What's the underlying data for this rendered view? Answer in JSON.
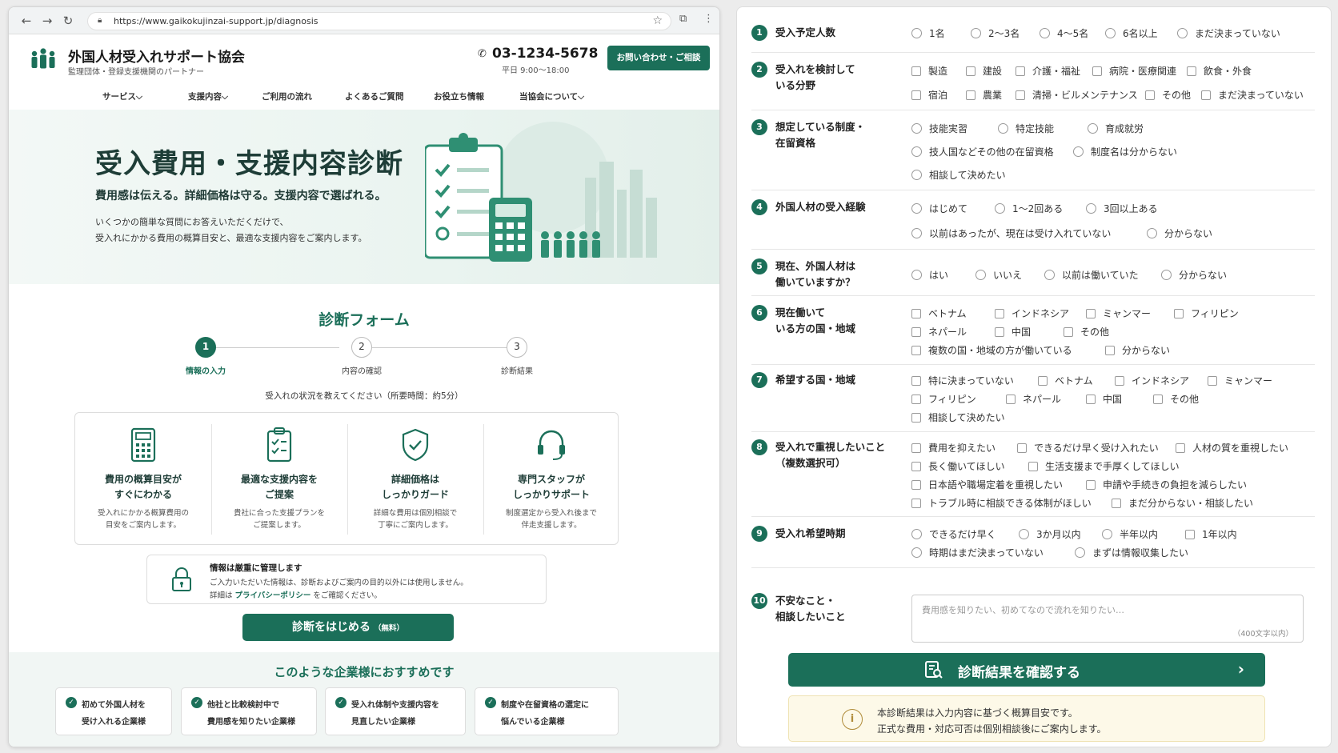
{
  "browser": {
    "url": "https://www.gaikokujinzai-support.jp/diagnosis"
  },
  "site": {
    "name": "外国人材受入れサポート協会",
    "subtitle": "監理団体・登録支援機関のパートナー",
    "phone": "03-1234-5678",
    "hours": "平日 9:00〜18:00",
    "contact_button": "お問い合わせ・ご相談"
  },
  "gnav": [
    "サービス⌵",
    "支援内容⌵",
    "ご利用の流れ",
    "よくあるご質問",
    "お役立ち情報",
    "当協会について⌵"
  ],
  "hero": {
    "title": "受入費用・支援内容診断",
    "subtitle": "費用感は伝える。詳細価格は守る。支援内容で選ばれる。",
    "desc1": "いくつかの簡単な質問にお答えいただくだけで、",
    "desc2": "受入れにかかる費用の概算目安と、最適な支援内容をご案内します。"
  },
  "form": {
    "title": "診断フォーム",
    "steps": [
      {
        "num": "1",
        "label": "情報の入力"
      },
      {
        "num": "2",
        "label": "内容の確認"
      },
      {
        "num": "3",
        "label": "診断結果"
      }
    ],
    "note": "受入れの状況を教えてください（所要時間：約5分）"
  },
  "features": [
    {
      "title1": "費用の概算目安が",
      "title2": "すぐにわかる",
      "desc1": "受入れにかかる概算費用の",
      "desc2": "目安をご案内します。"
    },
    {
      "title1": "最適な支援内容を",
      "title2": "ご提案",
      "desc1": "貴社に合った支援プランを",
      "desc2": "ご提案します。"
    },
    {
      "title1": "詳細価格は",
      "title2": "しっかりガード",
      "desc1": "詳細な費用は個別相談で",
      "desc2": "丁寧にご案内します。"
    },
    {
      "title1": "専門スタッフが",
      "title2": "しっかりサポート",
      "desc1": "制度選定から受入れ後まで",
      "desc2": "伴走支援します。"
    }
  ],
  "privacy": {
    "title": "情報は厳重に管理します",
    "line1": "ご入力いただいた情報は、診断およびご案内の目的以外には使用しません。",
    "line2_pre": "詳細は",
    "link": "プライバシーポリシー",
    "line2_post": "をご確認ください。"
  },
  "start_button": {
    "label": "診断をはじめる",
    "small": "（無料）"
  },
  "recommend": {
    "title": "このような企業様におすすめです",
    "cards": [
      {
        "l1": "初めて外国人材を",
        "l2": "受け入れる企業様"
      },
      {
        "l1": "他社と比較検討中で",
        "l2": "費用感を知りたい企業様"
      },
      {
        "l1": "受入れ体制や支援内容を",
        "l2": "見直したい企業様"
      },
      {
        "l1": "制度や在留資格の選定に",
        "l2": "悩んでいる企業様"
      }
    ]
  },
  "questions": {
    "q1": {
      "num": "1",
      "label": "受入予定人数",
      "options": [
        "1名",
        "2〜3名",
        "4〜5名",
        "6名以上",
        "まだ決まっていない"
      ]
    },
    "q2": {
      "num": "2",
      "label1": "受入れを検討して",
      "label2": "いる分野",
      "options": [
        "製造",
        "建設",
        "介護・福祉",
        "病院・医療関連",
        "飲食・外食",
        "宿泊",
        "農業",
        "清掃・ビルメンテナンス",
        "その他",
        "まだ決まっていない"
      ]
    },
    "q3": {
      "num": "3",
      "label1": "想定している制度・",
      "label2": "在留資格",
      "options": [
        "技能実習",
        "特定技能",
        "育成就労",
        "技人国などその他の在留資格",
        "制度名は分からない",
        "相談して決めたい"
      ]
    },
    "q4": {
      "num": "4",
      "label": "外国人材の受入経験",
      "options": [
        "はじめて",
        "1〜2回ある",
        "3回以上ある",
        "以前はあったが、現在は受け入れていない",
        "分からない"
      ]
    },
    "q5": {
      "num": "5",
      "label1": "現在、外国人材は",
      "label2": "働いていますか？",
      "options": [
        "はい",
        "いいえ",
        "以前は働いていた",
        "分からない"
      ]
    },
    "q6": {
      "num": "6",
      "label1": "現在働いて",
      "label2": "いる方の国・地域",
      "options": [
        "ベトナム",
        "インドネシア",
        "ミャンマー",
        "フィリピン",
        "ネパール",
        "中国",
        "その他",
        "複数の国・地域の方が働いている",
        "分からない"
      ]
    },
    "q7": {
      "num": "7",
      "label": "希望する国・地域",
      "options": [
        "特に決まっていない",
        "ベトナム",
        "インドネシア",
        "ミャンマー",
        "フィリピン",
        "ネパール",
        "中国",
        "その他",
        "相談して決めたい"
      ]
    },
    "q8": {
      "num": "8",
      "label1": "受入れで重視したいこと",
      "label2": "（複数選択可）",
      "options": [
        "費用を抑えたい",
        "できるだけ早く受け入れたい",
        "人材の質を重視したい",
        "長く働いてほしい",
        "生活支援まで手厚くしてほしい",
        "日本語や職場定着を重視したい",
        "申請や手続きの負担を減らしたい",
        "トラブル時に相談できる体制がほしい",
        "まだ分からない・相談したい"
      ]
    },
    "q9": {
      "num": "9",
      "label": "受入れ希望時期",
      "options": [
        "できるだけ早く",
        "3か月以内",
        "半年以内",
        "1年以内",
        "時期はまだ決まっていない",
        "まずは情報収集したい"
      ]
    },
    "q10": {
      "num": "10",
      "label1": "不安なこと・",
      "label2": "相談したいこと",
      "placeholder": "費用感を知りたい、初めてなので流れを知りたい…",
      "count": "（400文字以内）"
    }
  },
  "confirm_button": "診断結果を確認する",
  "notice": {
    "line1": "本診断結果は入力内容に基づく概算目安です。",
    "line2": "正式な費用・対応可否は個別相談後にご案内します。"
  },
  "colors": {
    "accent": "#1b6f59",
    "hero_title": "#1e3d37",
    "notice_bg": "#fdf9e8"
  }
}
